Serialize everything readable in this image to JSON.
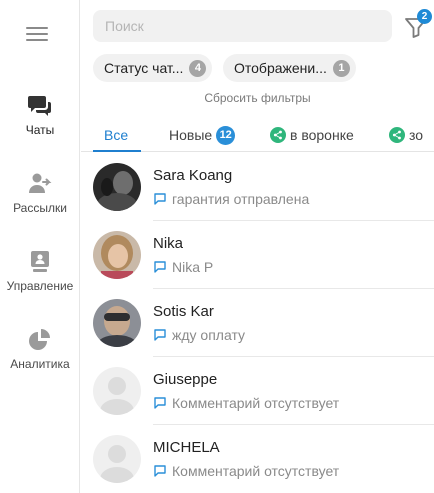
{
  "sidebar": {
    "items": [
      {
        "label": "Чаты",
        "icon": "chat-bubbles-icon",
        "active": true
      },
      {
        "label": "Рассылки",
        "icon": "users-arrow-icon"
      },
      {
        "label": "Управление",
        "icon": "manager-board-icon"
      },
      {
        "label": "Аналитика",
        "icon": "pie-chart-icon"
      }
    ]
  },
  "search": {
    "placeholder": "Поиск",
    "value": ""
  },
  "filter": {
    "badge": "2"
  },
  "chips": [
    {
      "label": "Статус чат...",
      "count": "4"
    },
    {
      "label": "Отображени...",
      "count": "1"
    }
  ],
  "reset_label": "Сбросить фильтры",
  "tabs": [
    {
      "label": "Все",
      "active": true
    },
    {
      "label": "Новые",
      "badge": "12"
    },
    {
      "label": "в воронке",
      "icon": "share-icon"
    },
    {
      "label": "зо",
      "icon": "share-icon"
    }
  ],
  "chats": [
    {
      "name": "Sara Koang",
      "preview": "гарантия отправлена"
    },
    {
      "name": "Nika",
      "preview": "Nika P"
    },
    {
      "name": "Sotis Kar",
      "preview": "жду оплату"
    },
    {
      "name": "Giuseppe",
      "preview": "Комментарий отсутствует"
    },
    {
      "name": "MICHELA",
      "preview": "Комментарий отсутствует"
    }
  ],
  "colors": {
    "accent": "#1f7fcf",
    "badge": "#2a8fd8",
    "green": "#2fb67c",
    "muted": "#8a8a8a"
  }
}
